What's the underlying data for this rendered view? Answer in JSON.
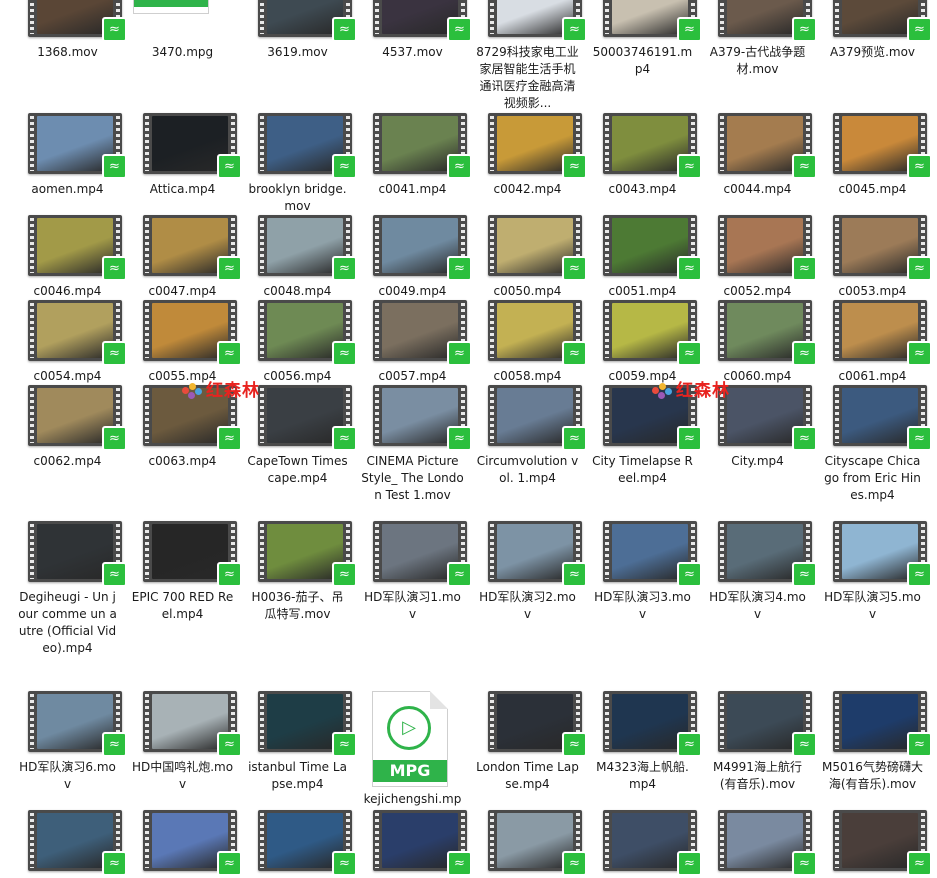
{
  "watermark": {
    "text": "红森林"
  },
  "colors": {
    "badge": "#2bbf3d",
    "mpg_bar": "#2fb34a"
  },
  "icons": {
    "badge": "audio-wave-icon",
    "play": "play-icon"
  },
  "files": [
    {
      "label": "1368.mov",
      "type": "video"
    },
    {
      "label": "3470.mpg",
      "type": "mpg"
    },
    {
      "label": "3619.mov",
      "type": "video"
    },
    {
      "label": "4537.mov",
      "type": "video"
    },
    {
      "label": "8729科技家电工业家居智能生活手机通讯医疗金融高清视频影...",
      "type": "video"
    },
    {
      "label": "50003746191.mp4",
      "type": "video"
    },
    {
      "label": "A379-古代战争题材.mov",
      "type": "video"
    },
    {
      "label": "A379预览.mov",
      "type": "video"
    },
    {
      "label": "aomen.mp4",
      "type": "video"
    },
    {
      "label": "Attica.mp4",
      "type": "video"
    },
    {
      "label": "brooklyn bridge.mov",
      "type": "video"
    },
    {
      "label": "c0041.mp4",
      "type": "video"
    },
    {
      "label": "c0042.mp4",
      "type": "video"
    },
    {
      "label": "c0043.mp4",
      "type": "video"
    },
    {
      "label": "c0044.mp4",
      "type": "video"
    },
    {
      "label": "c0045.mp4",
      "type": "video"
    },
    {
      "label": "c0046.mp4",
      "type": "video"
    },
    {
      "label": "c0047.mp4",
      "type": "video"
    },
    {
      "label": "c0048.mp4",
      "type": "video"
    },
    {
      "label": "c0049.mp4",
      "type": "video"
    },
    {
      "label": "c0050.mp4",
      "type": "video"
    },
    {
      "label": "c0051.mp4",
      "type": "video"
    },
    {
      "label": "c0052.mp4",
      "type": "video"
    },
    {
      "label": "c0053.mp4",
      "type": "video"
    },
    {
      "label": "c0054.mp4",
      "type": "video"
    },
    {
      "label": "c0055.mp4",
      "type": "video"
    },
    {
      "label": "c0056.mp4",
      "type": "video"
    },
    {
      "label": "c0057.mp4",
      "type": "video"
    },
    {
      "label": "c0058.mp4",
      "type": "video"
    },
    {
      "label": "c0059.mp4",
      "type": "video"
    },
    {
      "label": "c0060.mp4",
      "type": "video"
    },
    {
      "label": "c0061.mp4",
      "type": "video"
    },
    {
      "label": "c0062.mp4",
      "type": "video"
    },
    {
      "label": "c0063.mp4",
      "type": "video"
    },
    {
      "label": "CapeTown Timescape.mp4",
      "type": "video"
    },
    {
      "label": "CINEMA Picture Style_ The London Test 1.mov",
      "type": "video"
    },
    {
      "label": "Circumvolution vol. 1.mp4",
      "type": "video"
    },
    {
      "label": "City Timelapse Reel.mp4",
      "type": "video"
    },
    {
      "label": "City.mp4",
      "type": "video"
    },
    {
      "label": "Cityscape Chicago from Eric Hines.mp4",
      "type": "video"
    },
    {
      "label": "Degiheugi - Un jour comme un autre (Official Video).mp4",
      "type": "video"
    },
    {
      "label": "EPIC 700 RED Reel.mp4",
      "type": "video"
    },
    {
      "label": "H0036-茄子、吊瓜特写.mov",
      "type": "video"
    },
    {
      "label": "HD军队演习1.mov",
      "type": "video"
    },
    {
      "label": "HD军队演习2.mov",
      "type": "video"
    },
    {
      "label": "HD军队演习3.mov",
      "type": "video"
    },
    {
      "label": "HD军队演习4.mov",
      "type": "video"
    },
    {
      "label": "HD军队演习5.mov",
      "type": "video"
    },
    {
      "label": "HD军队演习6.mov",
      "type": "video"
    },
    {
      "label": "HD中国鸣礼炮.mov",
      "type": "video"
    },
    {
      "label": "istanbul Time Lapse.mp4",
      "type": "video"
    },
    {
      "label": "kejichengshi.mpg",
      "type": "mpg"
    },
    {
      "label": "London Time Lapse.mp4",
      "type": "video"
    },
    {
      "label": "M4323海上帆船.mp4",
      "type": "video"
    },
    {
      "label": "M4991海上航行(有音乐).mov",
      "type": "video"
    },
    {
      "label": "M5016气势磅礴大海(有音乐).mov",
      "type": "video"
    },
    {
      "label": "",
      "type": "video"
    },
    {
      "label": "",
      "type": "video"
    },
    {
      "label": "",
      "type": "video"
    },
    {
      "label": "",
      "type": "video"
    },
    {
      "label": "",
      "type": "video"
    },
    {
      "label": "",
      "type": "video"
    },
    {
      "label": "",
      "type": "video"
    },
    {
      "label": "",
      "type": "video"
    }
  ],
  "mpg_badge_text": "MPG",
  "thumb_colors": [
    "#5a4636",
    "#ffffff",
    "#3e4a52",
    "#3a3340",
    "#d8dde3",
    "#c8c0b0",
    "#6b5a4c",
    "#5c4a3a",
    "#6d8db0",
    "#1c2024",
    "#3e5f86",
    "#6a8250",
    "#c89a38",
    "#7f8e3e",
    "#a47c4f",
    "#c9893a",
    "#a29a48",
    "#b08d46",
    "#8fa1a8",
    "#6f8aa0",
    "#bfae70",
    "#4d7a34",
    "#a87654",
    "#9c7b58",
    "#b1a05e",
    "#c08a3a",
    "#6e8a54",
    "#7b6f5f",
    "#c3b153",
    "#b6b846",
    "#6f8a5d",
    "#bd8e4d",
    "#a08a5c",
    "#6c5a3e",
    "#3a3f44",
    "#7a8ea2",
    "#687c94",
    "#28364d",
    "#4b5466",
    "#3c5a7f",
    "#2f3336",
    "#262626",
    "#6f8d3e",
    "#6c7580",
    "#7d93a5",
    "#4d6e96",
    "#596c78",
    "#8fb5d2",
    "#6f8aa1",
    "#a8b2b6",
    "#1e3d46",
    "#ffffff",
    "#2b3038",
    "#1f3650",
    "#3c4a56",
    "#1e3c6a",
    "#3e5f7a",
    "#5a78b6",
    "#2f5a86",
    "#2a3e6a",
    "#8a9aa5",
    "#3e4e66",
    "#7a8aa0",
    "#4a3e3a"
  ]
}
